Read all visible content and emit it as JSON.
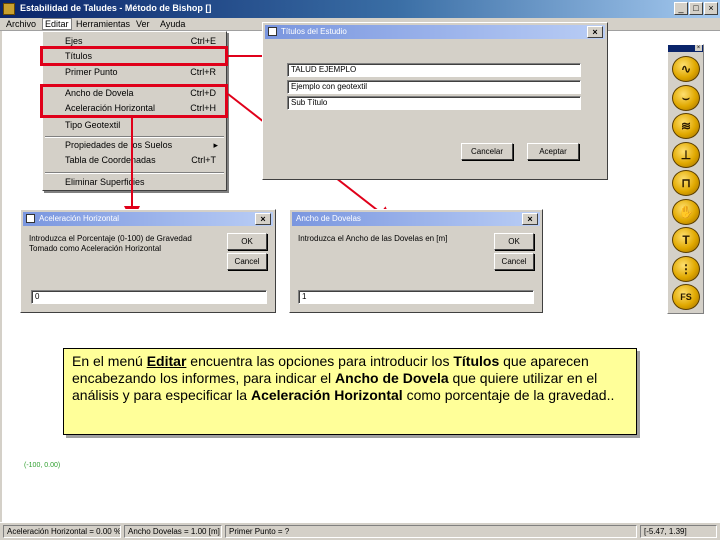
{
  "window": {
    "title": "Estabilidad de Taludes - Método de Bishop []"
  },
  "menubar": [
    "Archivo",
    "Editar",
    "Herramientas",
    "Ver",
    "Ayuda"
  ],
  "dropdown": {
    "ejes": {
      "label": "Ejes",
      "shortcut": "Ctrl+E"
    },
    "titulos": {
      "label": "Títulos"
    },
    "primer_punto": {
      "label": "Primer Punto",
      "shortcut": "Ctrl+R"
    },
    "ancho_dovela": {
      "label": "Ancho de Dovela",
      "shortcut": "Ctrl+D"
    },
    "aceleracion": {
      "label": "Aceleración Horizontal",
      "shortcut": "Ctrl+H"
    },
    "tipo_geotextil": {
      "label": "Tipo Geotextil"
    },
    "propiedades": {
      "label": "Propiedades de los Suelos"
    },
    "tabla": {
      "label": "Tabla de Coordenadas",
      "shortcut": "Ctrl+T"
    },
    "eliminar": {
      "label": "Eliminar Superficies"
    }
  },
  "titulos_dialog": {
    "title": "Títulos del Estudio",
    "field1": "TALUD EJEMPLO",
    "field2": "Ejemplo con geotextil",
    "field3": "Sub Título",
    "cancel": "Cancelar",
    "accept": "Aceptar"
  },
  "aceleracion_dialog": {
    "title": "Aceleración Horizontal",
    "prompt": "Introduzca el Porcentaje (0-100) de Gravedad\nTomado como Aceleración Horizontal",
    "ok": "OK",
    "cancel": "Cancel",
    "value": "0"
  },
  "dovelas_dialog": {
    "title": "Ancho de Dovelas",
    "prompt": "Introduzca el Ancho de las Dovelas en [m]",
    "ok": "OK",
    "cancel": "Cancel",
    "value": "1"
  },
  "toolbar": {
    "tools": [
      {
        "name": "curve-tool-icon",
        "glyph": "∿"
      },
      {
        "name": "arc-tool-icon",
        "glyph": "⌣"
      },
      {
        "name": "layers-tool-icon",
        "glyph": "≋"
      },
      {
        "name": "surface-tool-icon",
        "glyph": "⊥"
      },
      {
        "name": "wall-tool-icon",
        "glyph": "⊓"
      },
      {
        "name": "hand-tool-icon",
        "glyph": "✋"
      },
      {
        "name": "text-tool-icon",
        "glyph": "T"
      },
      {
        "name": "vertical-line-tool-icon",
        "glyph": "⋮"
      },
      {
        "name": "fs-tool-icon",
        "glyph": "FS"
      }
    ]
  },
  "callout": {
    "t1": "En el menú ",
    "b1": "Editar",
    "t2": " encuentra las opciones para introducir los ",
    "b2": "Títulos",
    "t3": " que aparecen encabezando los informes, para indicar el ",
    "b3": "Ancho de Dovela",
    "t4": " que quiere utilizar en el análisis y para especificar la ",
    "b4": "Aceleración Horizontal",
    "t5": " como porcentaje de la gravedad.."
  },
  "coordinate_label": "(-100, 0.00)",
  "statusbar": {
    "aceleracion": "Aceleración Horizontal = 0.00 %",
    "ancho": "Ancho Dovelas = 1.00 [m]",
    "primer_punto": "Primer Punto = ?",
    "cursor": "[-5.47, 1.39]"
  },
  "colors": {
    "highlight": "#e0001a",
    "callout_bg": "#ffff99",
    "titlebar": "#0a246a"
  }
}
